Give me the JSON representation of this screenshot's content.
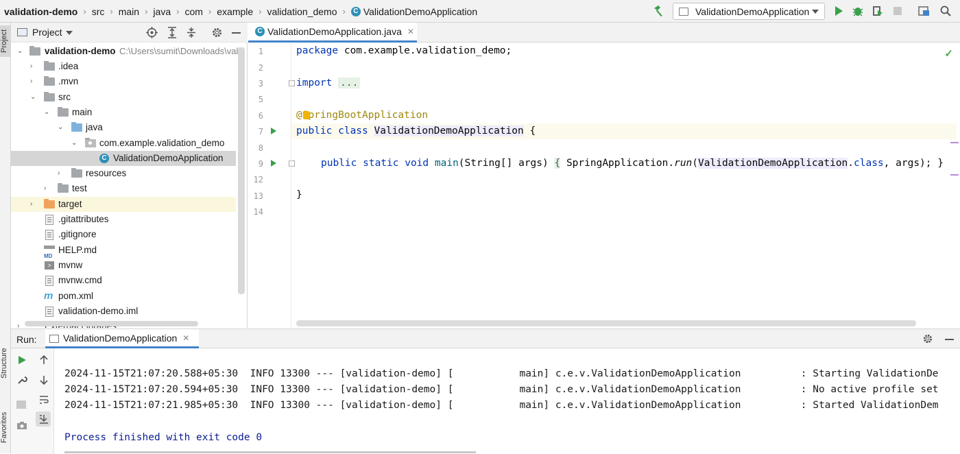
{
  "navbar": {
    "breadcrumbs": [
      "validation-demo",
      "src",
      "main",
      "java",
      "com",
      "example",
      "validation_demo",
      "ValidationDemoApplication"
    ],
    "run_config": "ValidationDemoApplication"
  },
  "left_stripe": {
    "project": "Project",
    "structure": "Structure",
    "favorites": "Favorites"
  },
  "project": {
    "title": "Project",
    "tree": [
      {
        "label": "validation-demo",
        "path": "C:\\Users\\sumit\\Downloads\\vali",
        "icon": "folder"
      },
      {
        "label": ".idea",
        "icon": "folder"
      },
      {
        "label": ".mvn",
        "icon": "folder"
      },
      {
        "label": "src",
        "icon": "folder"
      },
      {
        "label": "main",
        "icon": "folder"
      },
      {
        "label": "java",
        "icon": "source-folder"
      },
      {
        "label": "com.example.validation_demo",
        "icon": "package"
      },
      {
        "label": "ValidationDemoApplication",
        "icon": "class"
      },
      {
        "label": "resources",
        "icon": "resources-folder"
      },
      {
        "label": "test",
        "icon": "folder"
      },
      {
        "label": "target",
        "icon": "excluded-folder"
      },
      {
        "label": ".gitattributes",
        "icon": "file"
      },
      {
        "label": ".gitignore",
        "icon": "file"
      },
      {
        "label": "HELP.md",
        "icon": "markdown-file"
      },
      {
        "label": "mvnw",
        "icon": "script-file"
      },
      {
        "label": "mvnw.cmd",
        "icon": "file"
      },
      {
        "label": "pom.xml",
        "icon": "maven-file"
      },
      {
        "label": "validation-demo.iml",
        "icon": "file"
      },
      {
        "label": "External Libraries",
        "icon": "library"
      }
    ]
  },
  "editor": {
    "tab_label": "ValidationDemoApplication.java",
    "line_numbers": [
      "1",
      "2",
      "3",
      "5",
      "6",
      "7",
      "8",
      "9",
      "12",
      "13",
      "14"
    ],
    "code": {
      "l1_kw": "package",
      "l1_rest": " com.example.validation_demo;",
      "l3_kw": "import",
      "l3_fold": "...",
      "l6_at": "@",
      "l6_ann": "SpringBootApplication",
      "l7_kw": "public class",
      "l7_cls": "ValidationDemoApplication",
      "l7_rest": " {",
      "l9_kw": "public static void",
      "l9_meth": "main",
      "l9_params": "(String[] args) ",
      "l9_brace": "{",
      "l9_call": " SpringApplication.",
      "l9_run": "run",
      "l9_paren": "(",
      "l9_cls": "ValidationDemoApplication",
      "l9_dot": ".",
      "l9_class_kw": "class",
      "l9_end": ", args); }",
      "l13": "}"
    }
  },
  "run": {
    "label": "Run:",
    "tab_label": "ValidationDemoApplication",
    "logs": [
      "2024-11-15T21:07:20.588+05:30  INFO 13300 --- [validation-demo] [           main] c.e.v.ValidationDemoApplication          : Starting ValidationDe",
      "2024-11-15T21:07:20.594+05:30  INFO 13300 --- [validation-demo] [           main] c.e.v.ValidationDemoApplication          : No active profile set",
      "2024-11-15T21:07:21.985+05:30  INFO 13300 --- [validation-demo] [           main] c.e.v.ValidationDemoApplication          : Started ValidationDem"
    ],
    "finished": "Process finished with exit code 0"
  },
  "colors": {
    "keyword": "#0033b3",
    "annotation": "#9e880d",
    "run_green": "#3aa04b",
    "accent": "#4083c9"
  }
}
